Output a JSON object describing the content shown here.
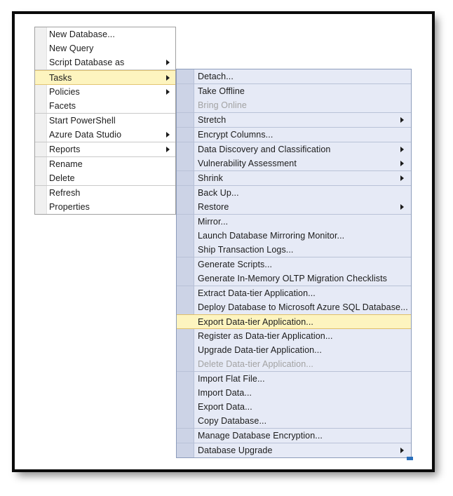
{
  "window": {
    "kind": "sql-server-management-studio-context-menu"
  },
  "colors": {
    "menu1_background": "#ffffff",
    "menu1_gutter": "#f0f0f0",
    "menu2_background": "#e6eaf6",
    "menu2_gutter": "#ccd3e6",
    "menu_border": "#8c9cbb",
    "highlight_fill": "#fdf4bf",
    "highlight_border": "#e0bf6a",
    "text": "#1b1b1b",
    "text_disabled": "#a2a2a2",
    "separator": "#b9c2d7",
    "frame": "#0a0a0a"
  },
  "context_menu": {
    "name": "database-context-menu",
    "items": [
      {
        "label": "New Database...",
        "submenu": false,
        "disabled": false,
        "highlighted": false,
        "separator_after": false
      },
      {
        "label": "New Query",
        "submenu": false,
        "disabled": false,
        "highlighted": false,
        "separator_after": false
      },
      {
        "label": "Script Database as",
        "submenu": true,
        "disabled": false,
        "highlighted": false,
        "separator_after": true
      },
      {
        "label": "Tasks",
        "submenu": true,
        "disabled": false,
        "highlighted": true,
        "separator_after": false
      },
      {
        "label": "Policies",
        "submenu": true,
        "disabled": false,
        "highlighted": false,
        "separator_after": false
      },
      {
        "label": "Facets",
        "submenu": false,
        "disabled": false,
        "highlighted": false,
        "separator_after": true
      },
      {
        "label": "Start PowerShell",
        "submenu": false,
        "disabled": false,
        "highlighted": false,
        "separator_after": false
      },
      {
        "label": "Azure Data Studio",
        "submenu": true,
        "disabled": false,
        "highlighted": false,
        "separator_after": true
      },
      {
        "label": "Reports",
        "submenu": true,
        "disabled": false,
        "highlighted": false,
        "separator_after": true
      },
      {
        "label": "Rename",
        "submenu": false,
        "disabled": false,
        "highlighted": false,
        "separator_after": false
      },
      {
        "label": "Delete",
        "submenu": false,
        "disabled": false,
        "highlighted": false,
        "separator_after": true
      },
      {
        "label": "Refresh",
        "submenu": false,
        "disabled": false,
        "highlighted": false,
        "separator_after": false
      },
      {
        "label": "Properties",
        "submenu": false,
        "disabled": false,
        "highlighted": false,
        "separator_after": false
      }
    ]
  },
  "tasks_submenu": {
    "name": "tasks-submenu",
    "items": [
      {
        "label": "Detach...",
        "submenu": false,
        "disabled": false,
        "highlighted": false,
        "separator_after": true
      },
      {
        "label": "Take Offline",
        "submenu": false,
        "disabled": false,
        "highlighted": false,
        "separator_after": false
      },
      {
        "label": "Bring Online",
        "submenu": false,
        "disabled": true,
        "highlighted": false,
        "separator_after": true
      },
      {
        "label": "Stretch",
        "submenu": true,
        "disabled": false,
        "highlighted": false,
        "separator_after": true
      },
      {
        "label": "Encrypt Columns...",
        "submenu": false,
        "disabled": false,
        "highlighted": false,
        "separator_after": true
      },
      {
        "label": "Data Discovery and Classification",
        "submenu": true,
        "disabled": false,
        "highlighted": false,
        "separator_after": false
      },
      {
        "label": "Vulnerability Assessment",
        "submenu": true,
        "disabled": false,
        "highlighted": false,
        "separator_after": true
      },
      {
        "label": "Shrink",
        "submenu": true,
        "disabled": false,
        "highlighted": false,
        "separator_after": true
      },
      {
        "label": "Back Up...",
        "submenu": false,
        "disabled": false,
        "highlighted": false,
        "separator_after": false
      },
      {
        "label": "Restore",
        "submenu": true,
        "disabled": false,
        "highlighted": false,
        "separator_after": true
      },
      {
        "label": "Mirror...",
        "submenu": false,
        "disabled": false,
        "highlighted": false,
        "separator_after": false
      },
      {
        "label": "Launch Database Mirroring Monitor...",
        "submenu": false,
        "disabled": false,
        "highlighted": false,
        "separator_after": false
      },
      {
        "label": "Ship Transaction Logs...",
        "submenu": false,
        "disabled": false,
        "highlighted": false,
        "separator_after": true
      },
      {
        "label": "Generate Scripts...",
        "submenu": false,
        "disabled": false,
        "highlighted": false,
        "separator_after": false
      },
      {
        "label": "Generate In-Memory OLTP Migration Checklists",
        "submenu": false,
        "disabled": false,
        "highlighted": false,
        "separator_after": true
      },
      {
        "label": "Extract Data-tier Application...",
        "submenu": false,
        "disabled": false,
        "highlighted": false,
        "separator_after": false
      },
      {
        "label": "Deploy Database to Microsoft Azure SQL Database...",
        "submenu": false,
        "disabled": false,
        "highlighted": false,
        "separator_after": false
      },
      {
        "label": "Export Data-tier Application...",
        "submenu": false,
        "disabled": false,
        "highlighted": true,
        "separator_after": false
      },
      {
        "label": "Register as Data-tier Application...",
        "submenu": false,
        "disabled": false,
        "highlighted": false,
        "separator_after": false
      },
      {
        "label": "Upgrade Data-tier Application...",
        "submenu": false,
        "disabled": false,
        "highlighted": false,
        "separator_after": false
      },
      {
        "label": "Delete Data-tier Application...",
        "submenu": false,
        "disabled": true,
        "highlighted": false,
        "separator_after": true
      },
      {
        "label": "Import Flat File...",
        "submenu": false,
        "disabled": false,
        "highlighted": false,
        "separator_after": false
      },
      {
        "label": "Import Data...",
        "submenu": false,
        "disabled": false,
        "highlighted": false,
        "separator_after": false
      },
      {
        "label": "Export Data...",
        "submenu": false,
        "disabled": false,
        "highlighted": false,
        "separator_after": false
      },
      {
        "label": "Copy Database...",
        "submenu": false,
        "disabled": false,
        "highlighted": false,
        "separator_after": true
      },
      {
        "label": "Manage Database Encryption...",
        "submenu": false,
        "disabled": false,
        "highlighted": false,
        "separator_after": true
      },
      {
        "label": "Database Upgrade",
        "submenu": true,
        "disabled": false,
        "highlighted": false,
        "separator_after": false
      }
    ]
  }
}
